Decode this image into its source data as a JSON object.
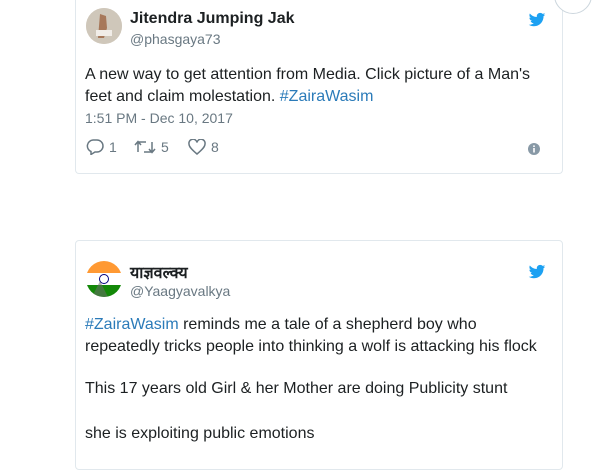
{
  "tweets": [
    {
      "name": "Jitendra Jumping Jak",
      "handle": "@phasgaya73",
      "text_line1": "A new way to get attention from Media. Click picture of a Man's",
      "text_line2_plain": "feet and claim molestation. ",
      "text_line2_hashtag": "#ZairaWasim",
      "timestamp": "1:51 PM - Dec 10, 2017",
      "replies": "1",
      "retweets": "5",
      "likes": "8",
      "icons": [
        "reply-icon",
        "retweet-icon",
        "like-icon",
        "info-icon",
        "twitter-bird-icon"
      ]
    },
    {
      "name": "याज्ञवल्क्य",
      "handle": "@Yaagyavalkya",
      "line1_hashtag": "#ZairaWasim",
      "line1_plain": " reminds me a tale of a shepherd boy who",
      "line2": "repeatedly tricks people into thinking a wolf is attacking his flock",
      "line3": "This 17 years old Girl & her Mother are doing Publicity stunt",
      "line4": "she is exploiting public emotions",
      "icons": [
        "twitter-bird-icon"
      ]
    }
  ],
  "colors": {
    "brand_blue": "#1da1f2",
    "hashtag": "#2b7bb9",
    "muted": "#697882",
    "border": "#e1e8ed"
  }
}
